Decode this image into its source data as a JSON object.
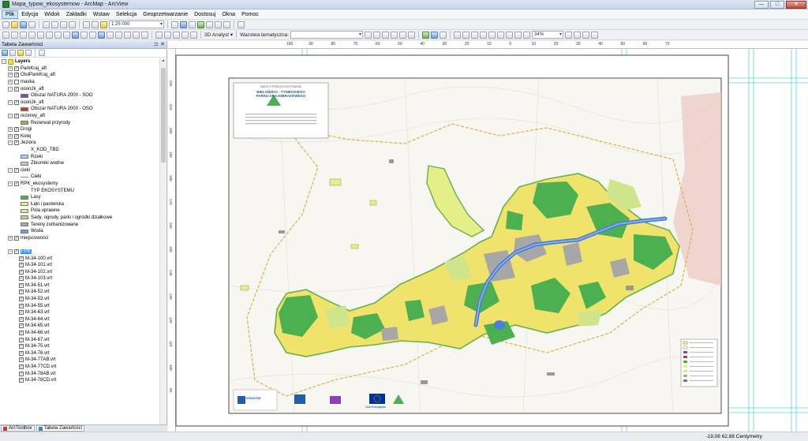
{
  "window": {
    "title": "Mapa_typow_ekosystemow - ArcMap - ArcView",
    "minimize": "—",
    "maximize": "□",
    "close": "✕"
  },
  "menu": [
    "Plik",
    "Edycja",
    "Widok",
    "Zakładki",
    "Wstaw",
    "Selekcja",
    "Geoprzetwarzanie",
    "Dostosuj",
    "Okna",
    "Pomoc"
  ],
  "toolbar": {
    "scale": "1:25 000",
    "analyst_3d": "3D Analyst ▾",
    "thematic_layer_label": "Warstwa tematyczna:",
    "zoom": "34%"
  },
  "toc": {
    "title": "Tabela Zawartości",
    "pin": "⊐",
    "close": "✕",
    "items": [
      {
        "label": "Layers",
        "level": 0,
        "expand": "−",
        "checkbox": false,
        "type": "group",
        "bold": true
      },
      {
        "label": "ParkKraj_aft",
        "level": 1,
        "expand": "+",
        "checked": true
      },
      {
        "label": "OtulParkKraj_aft",
        "level": 1,
        "expand": "+",
        "checked": true
      },
      {
        "label": "maska",
        "level": 1,
        "expand": "+",
        "checked": false
      },
      {
        "label": "ooon2k_aft",
        "level": 1,
        "expand": "−",
        "checked": true
      },
      {
        "label": "Obszar NATURA 2000 - SOO",
        "level": 2,
        "legend": true,
        "color": "#8e3fb5"
      },
      {
        "label": "ooon2k_aft",
        "level": 1,
        "expand": "−",
        "checked": true
      },
      {
        "label": "Obszar NATURA 2000 - OSO",
        "level": 2,
        "legend": true,
        "color": "#c0392b"
      },
      {
        "label": "rezerwy_aft",
        "level": 1,
        "expand": "−",
        "checked": true
      },
      {
        "label": "Rezerwat przyrody",
        "level": 2,
        "legend": true,
        "color": "#7bc142"
      },
      {
        "label": "Drogi",
        "level": 1,
        "expand": "+",
        "checked": true
      },
      {
        "label": "Kolej",
        "level": 1,
        "expand": "+",
        "checked": true
      },
      {
        "label": "Jeziora",
        "level": 1,
        "expand": "−",
        "checked": true
      },
      {
        "label": "X_KOD_TBD",
        "level": 2,
        "legend": false
      },
      {
        "label": "Rzeki",
        "level": 2,
        "legend": true,
        "color": "#a8d4f0"
      },
      {
        "label": "Zbiorniki wodne",
        "level": 2,
        "legend": true,
        "color": "#a8d4f0"
      },
      {
        "label": "cieki",
        "level": 1,
        "expand": "−",
        "checked": true
      },
      {
        "label": "Cieki",
        "level": 2,
        "legend": true,
        "color": "#5aa0d8",
        "line": true
      },
      {
        "label": "RPK_ekosystemy",
        "level": 1,
        "expand": "−",
        "checked": true
      },
      {
        "label": "TYP EKOSYSTEMU",
        "level": 2,
        "legend": false
      },
      {
        "label": "Lasy",
        "level": 2,
        "legend": true,
        "color": "#4caf50"
      },
      {
        "label": "Łąki i pastwiska",
        "level": 2,
        "legend": true,
        "color": "#e9f28a"
      },
      {
        "label": "Pola uprawne",
        "level": 2,
        "legend": true,
        "color": "#f4e27a"
      },
      {
        "label": "Sady, ogrody, parki i ogródki działkowe",
        "level": 2,
        "legend": true,
        "color": "#b8d68a"
      },
      {
        "label": "Tereny zurbanizowane",
        "level": 2,
        "legend": true,
        "color": "#a7a7a7"
      },
      {
        "label": "Woda",
        "level": 2,
        "legend": true,
        "color": "#6f9be0"
      },
      {
        "label": "miejscowości",
        "level": 1,
        "expand": "+",
        "checked": true
      },
      {
        "label": "",
        "level": 1,
        "spacer": true
      },
      {
        "label": "FPK",
        "level": 1,
        "expand": "−",
        "checked": true,
        "selected": true
      },
      {
        "label": "M-34-100.vrt",
        "level": 2,
        "checked": true
      },
      {
        "label": "M-34-101.vrt",
        "level": 2,
        "checked": true
      },
      {
        "label": "M-34-102.vrt",
        "level": 2,
        "checked": true
      },
      {
        "label": "M-34-103.vrt",
        "level": 2,
        "checked": true
      },
      {
        "label": "M-34-51.vrt",
        "level": 2,
        "checked": true
      },
      {
        "label": "M-34-52.vrt",
        "level": 2,
        "checked": true
      },
      {
        "label": "M-34-53.vrt",
        "level": 2,
        "checked": true
      },
      {
        "label": "M-34-55.vrt",
        "level": 2,
        "checked": true
      },
      {
        "label": "M-34-63.vrt",
        "level": 2,
        "checked": true
      },
      {
        "label": "M-34-64.vrt",
        "level": 2,
        "checked": true
      },
      {
        "label": "M-34-65.vrt",
        "level": 2,
        "checked": true
      },
      {
        "label": "M-34-66.vrt",
        "level": 2,
        "checked": true
      },
      {
        "label": "M-34-67.vrt",
        "level": 2,
        "checked": true
      },
      {
        "label": "M-34-75.vrt",
        "level": 2,
        "checked": true
      },
      {
        "label": "M-34-76.vrt",
        "level": 2,
        "checked": true
      },
      {
        "label": "M-34-77AB.vrt",
        "level": 2,
        "checked": true
      },
      {
        "label": "M-34-77CD.vrt",
        "level": 2,
        "checked": true
      },
      {
        "label": "M-34-78AB.vrt",
        "level": 2,
        "checked": true
      },
      {
        "label": "M-34-78CD.vrt",
        "level": 2,
        "checked": true
      }
    ],
    "tabs": [
      "ArcToolbox",
      "Tabela Zawartości"
    ]
  },
  "map": {
    "title_small": "MAPA TYPÓW EKOSYSTEMÓW",
    "title_line1": "BIELAŃSKO - TYNIECKIEGO",
    "title_line2": "PARKU KRAJOBRAZOWEGO",
    "logo_text": "KRAKÓW",
    "eu_text": "Unia Europejska"
  },
  "ruler_top": [
    "100",
    "90",
    "80",
    "70",
    "60",
    "50",
    "40",
    "30",
    "20",
    "10",
    "0",
    "10",
    "20",
    "30",
    "40",
    "50",
    "60",
    "70"
  ],
  "ruler_left": [
    "220",
    "210",
    "200",
    "190",
    "180",
    "170",
    "160",
    "150",
    "140",
    "130",
    "120",
    "110",
    "100",
    "90"
  ],
  "status": {
    "coords": "-19,08  62,88 Centymetry"
  },
  "colors": {
    "forest": "#4caf50",
    "field": "#f0e36b",
    "meadow": "#e4ef8a",
    "urban": "#9e9e9e",
    "water": "#4d7fd6",
    "boundary": "#d8b24a",
    "park_outline": "#64b24c",
    "guide": "#5fd0e6"
  }
}
